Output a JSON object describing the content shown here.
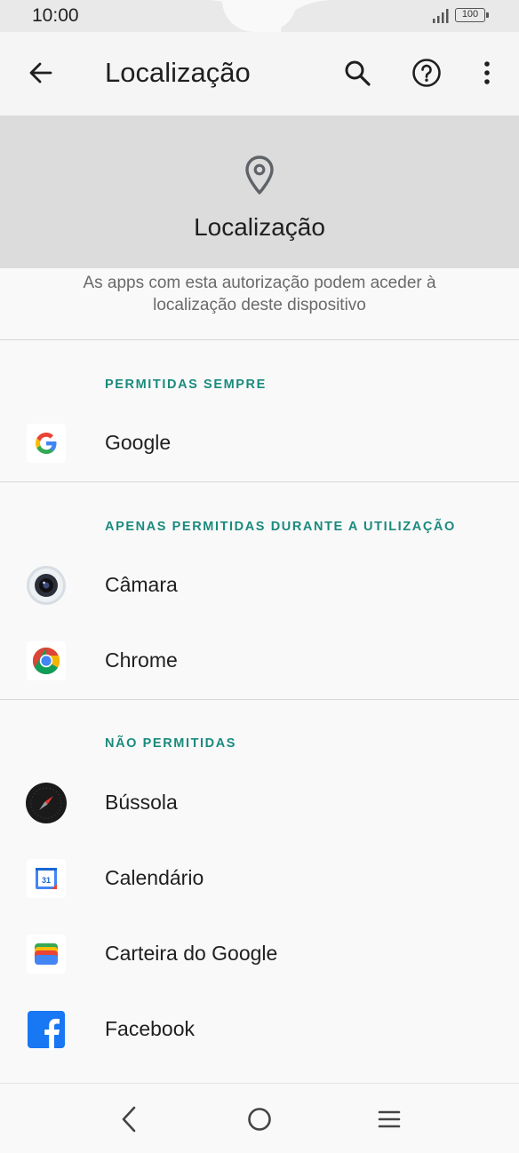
{
  "status": {
    "time": "10:00",
    "battery": "100"
  },
  "appbar": {
    "title": "Localização"
  },
  "header": {
    "title": "Localização",
    "description": "As apps com esta autorização podem aceder à localização deste dispositivo"
  },
  "sections": [
    {
      "title": "PERMITIDAS SEMPRE",
      "apps": [
        {
          "label": "Google",
          "icon": "google-icon"
        }
      ]
    },
    {
      "title": "APENAS PERMITIDAS DURANTE A UTILIZAÇÃO",
      "apps": [
        {
          "label": "Câmara",
          "icon": "camera-icon"
        },
        {
          "label": "Chrome",
          "icon": "chrome-icon"
        }
      ]
    },
    {
      "title": "NÃO PERMITIDAS",
      "apps": [
        {
          "label": "Bússola",
          "icon": "compass-icon"
        },
        {
          "label": "Calendário",
          "icon": "calendar-icon"
        },
        {
          "label": "Carteira do Google",
          "icon": "wallet-icon"
        },
        {
          "label": "Facebook",
          "icon": "facebook-icon"
        }
      ]
    }
  ],
  "icons": {
    "calendar_day": "31"
  },
  "colors": {
    "section_accent": "#1a8a7e",
    "header_bg": "#dcdcdc"
  }
}
